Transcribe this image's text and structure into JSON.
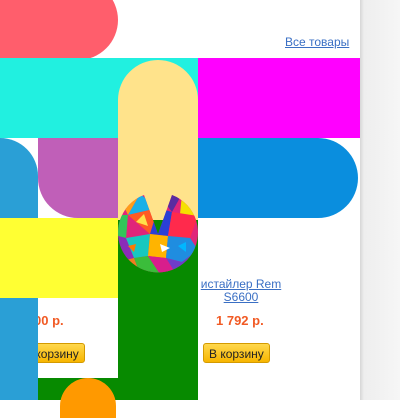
{
  "links": {
    "all_products": "Все товары"
  },
  "products": [
    {
      "title": "",
      "price": "00 р.",
      "button": "В корзину"
    },
    {
      "title": "истайлер Rem S6600",
      "price": "1 792 р.",
      "button": "В корзину"
    }
  ],
  "colors": {
    "red": "#ff5e6c",
    "cyan": "#21f0e0",
    "magenta": "#ff00ff",
    "purple": "#c05fb8",
    "peach": "#ffe38b",
    "blue": "#0a8ede",
    "yellow": "#ffff33",
    "green": "#078a00",
    "orange": "#ff9900",
    "sky": "#2a9fd6",
    "price": "#f15a24",
    "link": "#3a6fc4"
  }
}
